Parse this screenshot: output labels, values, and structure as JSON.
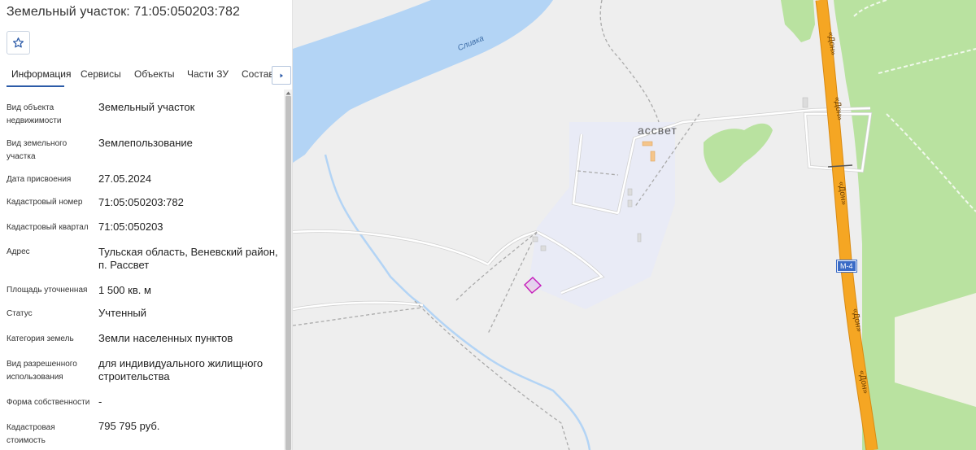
{
  "panel": {
    "title": "Земельный участок: 71:05:050203:782",
    "favorite_icon": "star-outline-icon",
    "tabs": [
      {
        "label": "Информация",
        "active": true
      },
      {
        "label": "Сервисы",
        "active": false
      },
      {
        "label": "Объекты",
        "active": false
      },
      {
        "label": "Части ЗУ",
        "active": false
      },
      {
        "label": "Состав",
        "active": false
      }
    ],
    "tabs_next_icon": "caret-right-icon",
    "accent_color": "#2c5ba8",
    "fields": [
      {
        "label": "Вид объекта недвижимости",
        "value": "Земельный участок"
      },
      {
        "label": "Вид земельного участка",
        "value": "Землепользование"
      },
      {
        "label": "Дата присвоения",
        "value": "27.05.2024"
      },
      {
        "label": "Кадастровый номер",
        "value": "71:05:050203:782"
      },
      {
        "label": "Кадастровый квартал",
        "value": "71:05:050203"
      },
      {
        "label": "Адрес",
        "value": "Тульская область, Веневский район, п. Рассвет"
      },
      {
        "label": "Площадь уточненная",
        "value": "1 500 кв. м"
      },
      {
        "label": "Статус",
        "value": "Учтенный"
      },
      {
        "label": "Категория земель",
        "value": "Земли населенных пунктов"
      },
      {
        "label": "Вид разрешенного использования",
        "value": "для индивидуального жилищного строительства"
      },
      {
        "label": "Форма собственности",
        "value": "-"
      },
      {
        "label": "Кадастровая стоимость",
        "value": "795 795 руб."
      }
    ]
  },
  "map": {
    "labels": {
      "river": "Сливка",
      "village": "ассвет",
      "highway_name": "«Дон»",
      "highway_shield": "М-4"
    },
    "colors": {
      "water": "#b3d4f5",
      "forest": "#b9e2a0",
      "highway": "#f5a623",
      "parcel": "#c51cbb",
      "background": "#eeeeee"
    }
  }
}
